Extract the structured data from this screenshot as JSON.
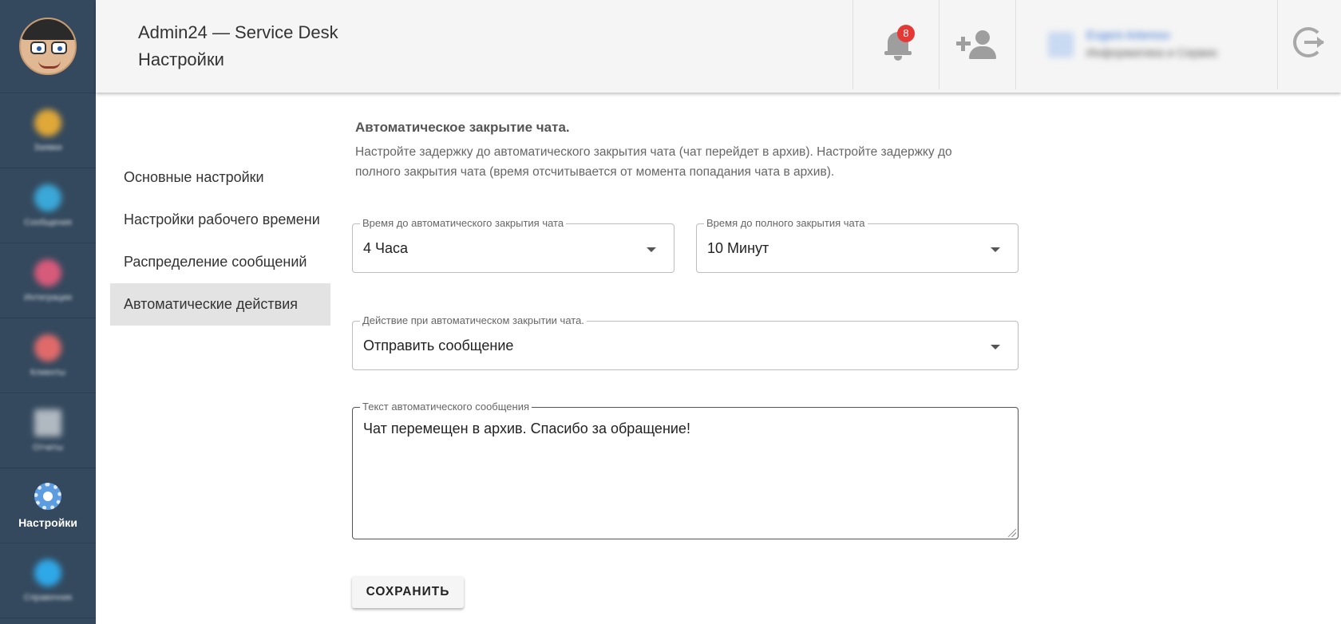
{
  "app": {
    "name": "Admin24 — Service Desk",
    "page": "Настройки"
  },
  "header": {
    "notification_count": "8",
    "user_name": "Evgeni Artemov",
    "user_org": "Информатика и Сервис"
  },
  "nav": {
    "items": [
      {
        "label": "Заявки",
        "icon": "tickets-icon",
        "color": "#e0a838"
      },
      {
        "label": "Сообщения",
        "icon": "messages-icon",
        "color": "#3aa8d8"
      },
      {
        "label": "Интеграции",
        "icon": "integrations-icon",
        "color": "#d85a7a"
      },
      {
        "label": "Клиенты",
        "icon": "clients-icon",
        "color": "#e06a6a"
      },
      {
        "label": "Отчеты",
        "icon": "reports-icon",
        "color": "#b0b8c0"
      },
      {
        "label": "Настройки",
        "icon": "gear-icon",
        "color": "#5c9ce0",
        "active": true
      },
      {
        "label": "Справочник",
        "icon": "help-icon",
        "color": "#2fa8e8"
      }
    ]
  },
  "settings_menu": {
    "items": [
      {
        "label": "Основные настройки"
      },
      {
        "label": "Настройки рабочего времени"
      },
      {
        "label": "Распределение сообщений"
      },
      {
        "label": "Автоматические действия",
        "active": true
      }
    ]
  },
  "section": {
    "title": "Автоматическое закрытие чата.",
    "description": "Настройте задержку до автоматического закрытия чата (чат перейдет в архив). Настройте задержку до полного закрытия чата (время отсчитывается от момента попадания чата в архив)."
  },
  "fields": {
    "auto_close_delay": {
      "label": "Время до автоматического закрытия чата",
      "value": "4 Часа"
    },
    "full_close_delay": {
      "label": "Время до полного закрытия чата",
      "value": "10 Минут"
    },
    "auto_close_action": {
      "label": "Действие при автоматическом закрытии чата.",
      "value": "Отправить сообщение"
    },
    "auto_message": {
      "label": "Текст автоматического сообщения",
      "value": "Чат перемещен в архив. Спасибо за обращение!"
    }
  },
  "actions": {
    "save_label": "СОХРАНИТЬ"
  }
}
